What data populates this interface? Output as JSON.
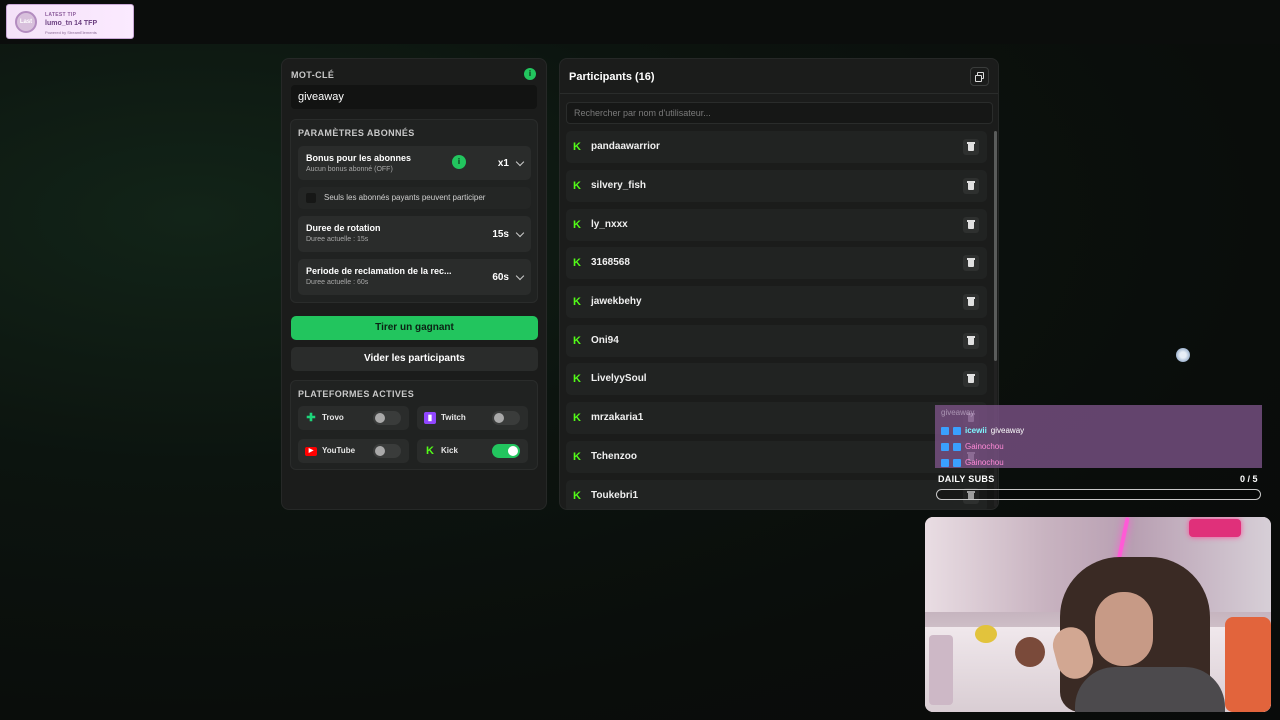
{
  "tip_widget": {
    "kicker": "LATEST TIP",
    "text": "lumo_tn 14 TFP",
    "powered": "Powered by StreamElements",
    "avatar_text": "Last"
  },
  "keyword": {
    "label": "MOT-CLÉ",
    "value": "giveaway",
    "info_icon": "info-icon"
  },
  "subscriber_settings": {
    "header": "PARAMÈTRES ABONNÉS",
    "bonus": {
      "title": "Bonus pour les abonnes",
      "subtitle": "Aucun bonus abonné (OFF)",
      "value": "x1"
    },
    "paid_only": {
      "label": "Seuls les abonnés payants peuvent participer",
      "checked": false
    },
    "rotation": {
      "title": "Duree de rotation",
      "subtitle": "Duree actuelle : 15s",
      "value": "15s"
    },
    "claim": {
      "title": "Periode de reclamation de la rec...",
      "subtitle": "Duree actuelle : 60s",
      "value": "60s"
    }
  },
  "actions": {
    "draw_winner": "Tirer un gagnant",
    "clear_participants": "Vider les participants"
  },
  "platforms": {
    "header": "PLATEFORMES ACTIVES",
    "items": [
      {
        "name": "Trovo",
        "enabled": false,
        "color": "#1dd57a"
      },
      {
        "name": "Twitch",
        "enabled": false,
        "color": "#9146ff"
      },
      {
        "name": "YouTube",
        "enabled": false,
        "color": "#ff0000"
      },
      {
        "name": "Kick",
        "enabled": true,
        "color": "#53fc18"
      }
    ]
  },
  "participants": {
    "title": "Participants (16)",
    "search_placeholder": "Rechercher par nom d'utilisateur...",
    "list": [
      "pandaawarrior",
      "silvery_fish",
      "ly_nxxx",
      "3168568",
      "jawekbehy",
      "Oni94",
      "LivelyySoul",
      "mrzakaria1",
      "Tchenzoo",
      "Toukebri1"
    ]
  },
  "chat_overlay": {
    "lines": [
      {
        "user": "",
        "message": "giveaway"
      },
      {
        "user": "icewii",
        "message": "giveaway"
      },
      {
        "user": "Gainochou",
        "message": ""
      },
      {
        "user": "Gainochou",
        "message": ""
      }
    ]
  },
  "daily_subs": {
    "label": "DAILY SUBS",
    "count": "0 / 5",
    "progress": 0
  },
  "colors": {
    "accent": "#22c55e",
    "kick": "#53fc18",
    "panel": "#1b1c1b"
  }
}
